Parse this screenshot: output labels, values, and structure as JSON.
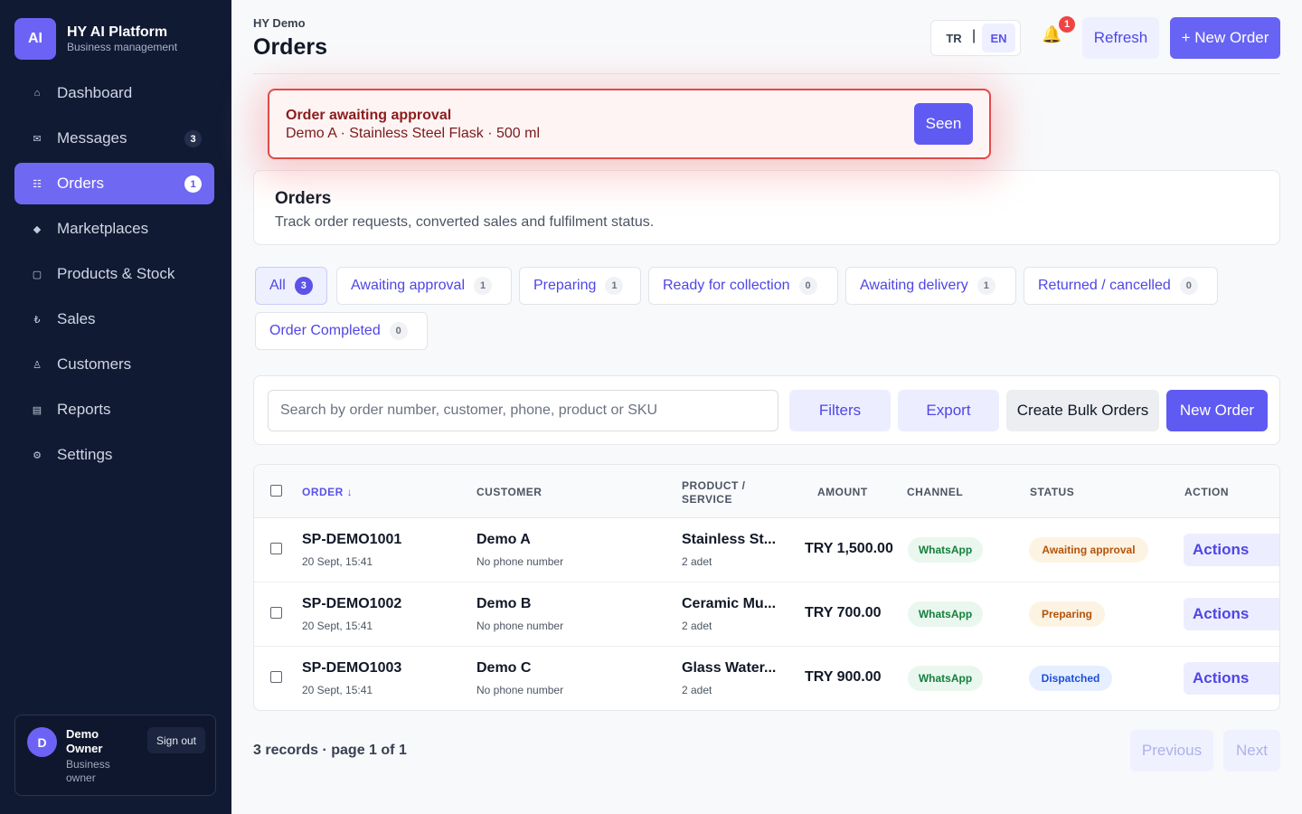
{
  "brand": {
    "logo": "AI",
    "title": "HY AI Platform",
    "subtitle": "Business management"
  },
  "nav": [
    {
      "label": "Dashboard",
      "icon": "home-icon",
      "glyph": "⌂",
      "badge": null
    },
    {
      "label": "Messages",
      "icon": "mail-icon",
      "glyph": "✉",
      "badge": "3"
    },
    {
      "label": "Orders",
      "icon": "list-icon",
      "glyph": "☷",
      "badge": "1",
      "active": true
    },
    {
      "label": "Marketplaces",
      "icon": "diamond-icon",
      "glyph": "◆",
      "badge": null
    },
    {
      "label": "Products & Stock",
      "icon": "box-icon",
      "glyph": "▢",
      "badge": null
    },
    {
      "label": "Sales",
      "icon": "lira-icon",
      "glyph": "₺",
      "badge": null
    },
    {
      "label": "Customers",
      "icon": "user-icon",
      "glyph": "♙",
      "badge": null
    },
    {
      "label": "Reports",
      "icon": "report-icon",
      "glyph": "▤",
      "badge": null
    },
    {
      "label": "Settings",
      "icon": "gear-icon",
      "glyph": "⚙",
      "badge": null
    }
  ],
  "user": {
    "initial": "D",
    "name": "Demo Owner",
    "role": "Business owner",
    "signout": "Sign out"
  },
  "header": {
    "breadcrumb": "HY Demo",
    "title": "Orders",
    "lang_tr": "TR",
    "lang_sep": "|",
    "lang_en": "EN",
    "bell_count": "1",
    "refresh": "Refresh",
    "new_order": "+ New Order"
  },
  "alert": {
    "title": "Order awaiting approval",
    "text": "Demo A · Stainless Steel Flask · 500 ml",
    "button": "Seen"
  },
  "orders_card": {
    "title": "Orders",
    "description": "Track order requests, converted sales and fulfilment status."
  },
  "tabs": [
    {
      "label": "All",
      "count": "3",
      "active": true
    },
    {
      "label": "Awaiting approval",
      "count": "1"
    },
    {
      "label": "Preparing",
      "count": "1"
    },
    {
      "label": "Ready for collection",
      "count": "0"
    },
    {
      "label": "Awaiting delivery",
      "count": "1"
    },
    {
      "label": "Returned / cancelled",
      "count": "0"
    },
    {
      "label": "Order Completed",
      "count": "0"
    }
  ],
  "toolbar": {
    "search_placeholder": "Search by order number, customer, phone, product or SKU",
    "filters": "Filters",
    "export": "Export",
    "bulk": "Create Bulk Orders",
    "new_order": "New Order"
  },
  "table": {
    "columns": {
      "order": "ORDER ↓",
      "customer": "CUSTOMER",
      "product_line1": "PRODUCT /",
      "product_line2": "SERVICE",
      "amount": "AMOUNT",
      "channel": "CHANNEL",
      "status": "STATUS",
      "action": "ACTION"
    },
    "rows": [
      {
        "order": "SP-DEMO1001",
        "date": "20 Sept, 15:41",
        "customer": "Demo A",
        "phone": "No phone number",
        "product": "Stainless St...",
        "qty": "2 adet",
        "amount": "TRY 1,500.00",
        "channel": "WhatsApp",
        "status": "Awaiting approval",
        "status_kind": "await",
        "action": "Actions"
      },
      {
        "order": "SP-DEMO1002",
        "date": "20 Sept, 15:41",
        "customer": "Demo B",
        "phone": "No phone number",
        "product": "Ceramic Mu...",
        "qty": "2 adet",
        "amount": "TRY 700.00",
        "channel": "WhatsApp",
        "status": "Preparing",
        "status_kind": "prep",
        "action": "Actions"
      },
      {
        "order": "SP-DEMO1003",
        "date": "20 Sept, 15:41",
        "customer": "Demo C",
        "phone": "No phone number",
        "product": "Glass Water...",
        "qty": "2 adet",
        "amount": "TRY 900.00",
        "channel": "WhatsApp",
        "status": "Dispatched",
        "status_kind": "disp",
        "action": "Actions"
      }
    ]
  },
  "pagination": {
    "summary": "3 records · page 1 of 1",
    "previous": "Previous",
    "next": "Next"
  },
  "colors": {
    "accent": "#6c63f6",
    "sidebar_bg": "#111a33",
    "alert_border": "#e04a4a"
  }
}
